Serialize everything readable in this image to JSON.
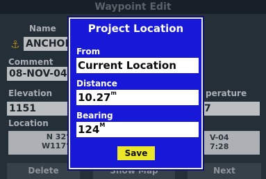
{
  "background": {
    "title": "Waypoint Edit",
    "name_label": "Name",
    "name_value": "ANCHOR",
    "comment_label": "Comment",
    "comment_value": "08-NOV-04",
    "elevation_label": "Elevation",
    "elevation_value": "1151",
    "temperature_label": "perature",
    "temperature_value": "7",
    "location_label": "Location",
    "location_lat": "N  32°",
    "location_lon": "W117°",
    "right_date": "V-04",
    "right_time": "7:28",
    "buttons": [
      "Delete",
      "Show Map",
      "Next"
    ]
  },
  "dialog": {
    "title": "Project Location",
    "from_label": "From",
    "from_value": "Current Location",
    "distance_label": "Distance",
    "distance_value": "10.27",
    "distance_unit": "m",
    "bearing_label": "Bearing",
    "bearing_value": "124",
    "bearing_unit": "M",
    "save_label": "Save"
  },
  "colors": {
    "dialog_bg": "#1818d8",
    "save_button": "#ece62a",
    "page_bg": "#2e3a45"
  },
  "icons": [
    "anchor-icon"
  ]
}
